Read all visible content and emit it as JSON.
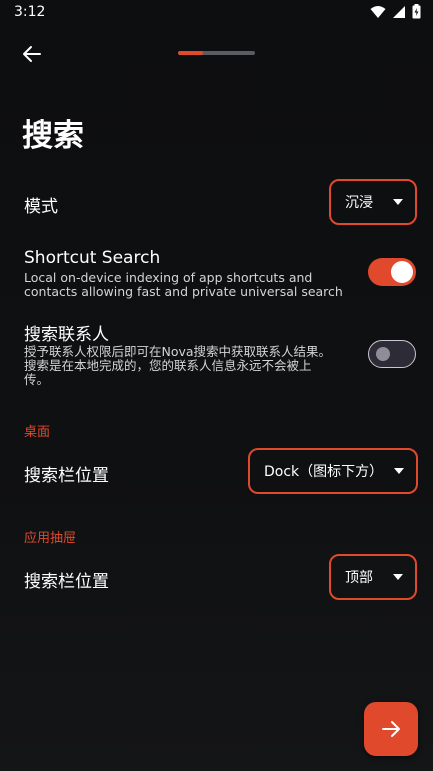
{
  "status_bar": {
    "time": "3:12",
    "icons": [
      "wifi-icon",
      "signal-icon",
      "battery-icon"
    ]
  },
  "header": {
    "back_icon": "back-arrow-icon",
    "progress_fraction": 0.33
  },
  "page_title": "搜索",
  "search": {
    "mode": {
      "label": "模式",
      "value": "沉浸"
    },
    "shortcut_search": {
      "label": "Shortcut Search",
      "desc_line1": "Local on-device indexing of app shortcuts and",
      "desc_line2": "contacts allowing fast and private universal search",
      "enabled": true
    },
    "contacts": {
      "label": "搜索联系人",
      "desc_line1": "授予联系人权限后即可在Nova搜索中获取联系人结果。",
      "desc_line2": "搜索是在本地完成的，您的联系人信息永远不会被上",
      "desc_line3": "传。",
      "enabled": false
    }
  },
  "desktop": {
    "header": "桌面",
    "searchbar_position": {
      "label": "搜索栏位置",
      "value": "Dock（图标下方）"
    }
  },
  "app_drawer": {
    "header": "应用抽屉",
    "searchbar_position": {
      "label": "搜索栏位置",
      "value": "顶部"
    }
  },
  "fab": {
    "icon": "arrow-right-icon"
  },
  "colors": {
    "accent": "#e0492b",
    "background": "#0f1012",
    "toggle_off_track": "#2d2b35"
  }
}
